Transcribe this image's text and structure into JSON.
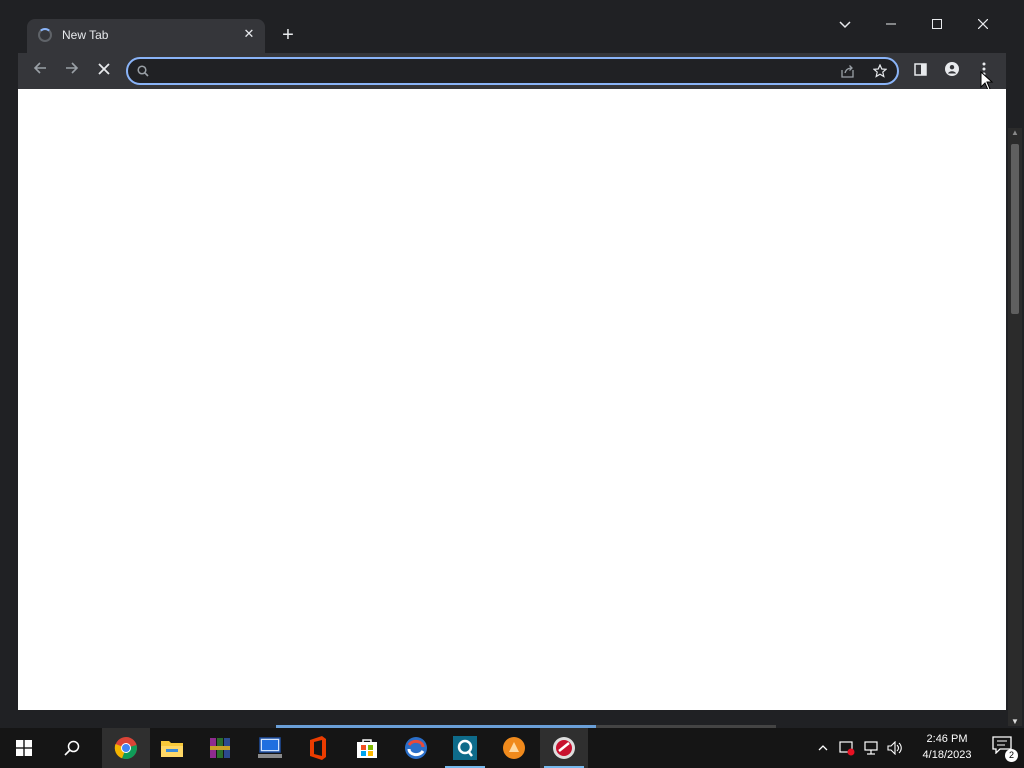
{
  "browser": {
    "tab": {
      "title": "New Tab",
      "close_glyph": "✕"
    },
    "new_tab_glyph": "+",
    "window_controls": {
      "tab_search": "⌄",
      "minimize": "—",
      "maximize": "☐",
      "close": "✕"
    },
    "toolbar": {
      "back": "←",
      "forward": "→",
      "stop": "✕",
      "omnibox": {
        "value": "",
        "placeholder": ""
      },
      "share_glyph": "⇪",
      "bookmark_glyph": "☆",
      "menu_glyph": "⋮"
    }
  },
  "taskbar": {
    "apps": [
      {
        "name": "start",
        "icon": "windows-logo-icon"
      },
      {
        "name": "search",
        "icon": "search-icon"
      },
      {
        "name": "chrome",
        "icon": "chrome-icon"
      },
      {
        "name": "file-explorer",
        "icon": "folder-icon"
      },
      {
        "name": "winrar",
        "icon": "winrar-icon"
      },
      {
        "name": "remote-desktop",
        "icon": "computer-icon"
      },
      {
        "name": "office",
        "icon": "office-icon"
      },
      {
        "name": "store",
        "icon": "store-icon"
      },
      {
        "name": "app-swirl",
        "icon": "swirl-app-icon"
      },
      {
        "name": "app-q",
        "icon": "q-app-icon"
      },
      {
        "name": "app-orange",
        "icon": "orange-app-icon"
      },
      {
        "name": "app-red",
        "icon": "red-app-icon"
      }
    ],
    "clock": {
      "time": "2:46 PM",
      "date": "4/18/2023"
    },
    "notifications": {
      "count": "2"
    }
  }
}
